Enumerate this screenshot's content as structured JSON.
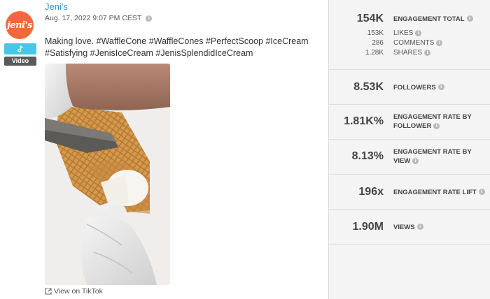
{
  "post": {
    "avatar_text": "jeni's",
    "platform_icon": "tiktok-icon",
    "type_badge": "Video",
    "author": "Jeni's",
    "date": "Aug. 17, 2022 9:07 PM CEST",
    "caption": "Making love. #WaffleCone #WaffleCones #PerfectScoop #IceCream #Satisfying #JenisIceCream #JenisSplendidIceCream",
    "view_link": "View on TikTok"
  },
  "stats": {
    "engagement_total": {
      "value": "154K",
      "label": "ENGAGEMENT TOTAL"
    },
    "likes": {
      "value": "153K",
      "label": "LIKES"
    },
    "comments": {
      "value": "286",
      "label": "COMMENTS"
    },
    "shares": {
      "value": "1.28K",
      "label": "SHARES"
    },
    "followers": {
      "value": "8.53K",
      "label": "FOLLOWERS"
    },
    "er_follower": {
      "value": "1.81K%",
      "label1": "ENGAGEMENT RATE BY",
      "label2": "FOLLOWER"
    },
    "er_view": {
      "value": "8.13%",
      "label1": "ENGAGEMENT RATE BY",
      "label2": "VIEW"
    },
    "er_lift": {
      "value": "196x",
      "label": "ENGAGEMENT RATE LIFT"
    },
    "views": {
      "value": "1.90M",
      "label": "VIEWS"
    }
  },
  "colors": {
    "brand": "#ee6a3c",
    "tiktok_badge": "#46c7e8",
    "link": "#3a8fc4"
  }
}
